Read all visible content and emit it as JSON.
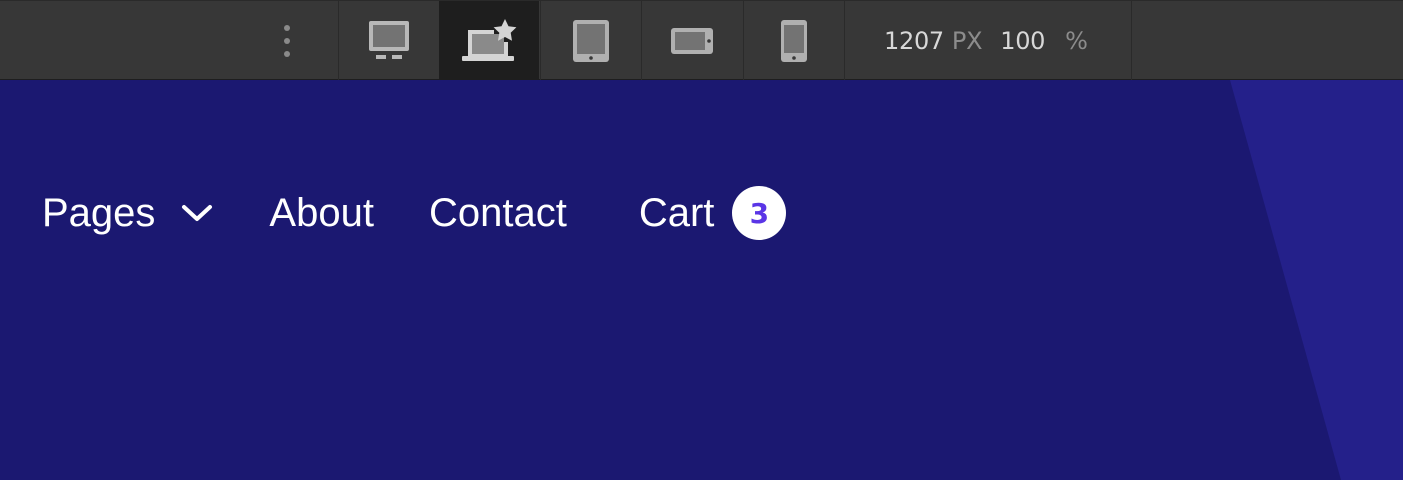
{
  "toolbar": {
    "devices": [
      {
        "name": "desktop-icon",
        "active": false
      },
      {
        "name": "laptop-star-icon",
        "active": true
      },
      {
        "name": "tablet-portrait-icon",
        "active": false
      },
      {
        "name": "tablet-landscape-icon",
        "active": false
      },
      {
        "name": "phone-icon",
        "active": false
      }
    ],
    "width_value": "1207",
    "width_unit": "PX",
    "zoom_value": "100",
    "zoom_unit": "%"
  },
  "nav": {
    "pages_label": "Pages",
    "about_label": "About",
    "contact_label": "Contact",
    "cart_label": "Cart",
    "cart_count": "3"
  },
  "colors": {
    "toolbar_bg": "#373737",
    "active_device_bg": "#1e1e1e",
    "canvas_bg": "#1b1871",
    "canvas_accent": "#24208a",
    "badge_text": "#5a35e6"
  }
}
